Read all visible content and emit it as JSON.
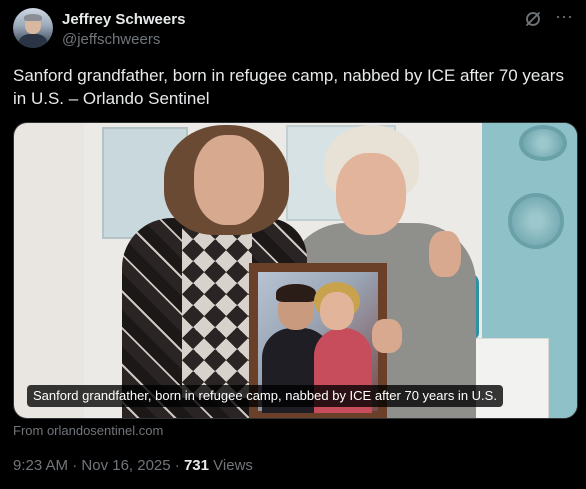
{
  "author": {
    "display_name": "Jeffrey Schweers",
    "handle": "@jeffschweers",
    "avatar_icon": "avatar-photo"
  },
  "header_icons": {
    "grok": "grok-icon",
    "more": "more-horizontal-icon",
    "more_glyph": "···"
  },
  "tweet": {
    "text": "Sanford grandfather, born in refugee camp, nabbed by ICE after 70 years in U.S. – Orlando Sentinel"
  },
  "link_card": {
    "image_caption": "Sanford grandfather, born in refugee camp, nabbed by ICE after 70 years in U.S.",
    "source": "From orlandosentinel.com"
  },
  "meta": {
    "time": "9:23 AM",
    "separator1": " · ",
    "date": "Nov 16, 2025",
    "separator2": " · ",
    "views_count": "731",
    "views_label": " Views"
  },
  "colors": {
    "background": "#000000",
    "text_primary": "#e7e9ea",
    "text_secondary": "#71767b",
    "border": "#2f3336"
  }
}
